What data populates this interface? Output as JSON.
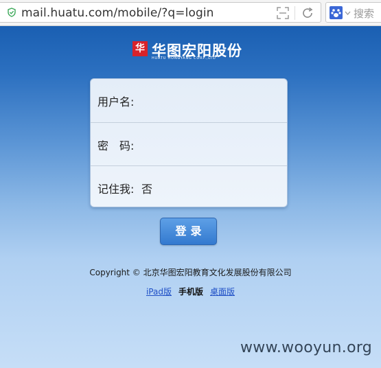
{
  "browser": {
    "url": "mail.huatu.com/mobile/?q=login",
    "search_placeholder": "搜索"
  },
  "brand": {
    "name": "华图宏阳股份",
    "subtitle": "HUATU HONGYANG CORP.,LTD",
    "mark": "华"
  },
  "login_form": {
    "username_label": "用户名:",
    "password_label": "密　码:",
    "remember_label": "记住我:",
    "remember_value": "否",
    "submit_label": "登录"
  },
  "footer": {
    "copyright": "Copyright © 北京华图宏阳教育文化发展股份有限公司",
    "links": {
      "ipad": "iPad版",
      "mobile": "手机版",
      "desktop": "桌面版"
    }
  },
  "watermark": "www.wooyun.org",
  "colors": {
    "header_blue": "#1a5fb2",
    "button_blue": "#3379cf",
    "brand_red": "#d8232a",
    "link_blue": "#1f4fc6"
  }
}
